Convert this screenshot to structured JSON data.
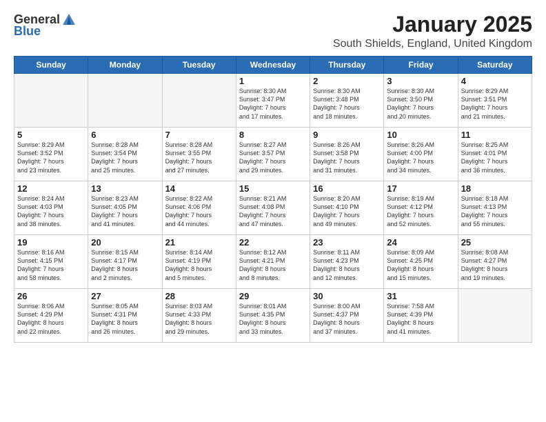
{
  "logo": {
    "general": "General",
    "blue": "Blue"
  },
  "title": "January 2025",
  "subtitle": "South Shields, England, United Kingdom",
  "days_of_week": [
    "Sunday",
    "Monday",
    "Tuesday",
    "Wednesday",
    "Thursday",
    "Friday",
    "Saturday"
  ],
  "weeks": [
    [
      {
        "day": "",
        "info": ""
      },
      {
        "day": "",
        "info": ""
      },
      {
        "day": "",
        "info": ""
      },
      {
        "day": "1",
        "info": "Sunrise: 8:30 AM\nSunset: 3:47 PM\nDaylight: 7 hours\nand 17 minutes."
      },
      {
        "day": "2",
        "info": "Sunrise: 8:30 AM\nSunset: 3:48 PM\nDaylight: 7 hours\nand 18 minutes."
      },
      {
        "day": "3",
        "info": "Sunrise: 8:30 AM\nSunset: 3:50 PM\nDaylight: 7 hours\nand 20 minutes."
      },
      {
        "day": "4",
        "info": "Sunrise: 8:29 AM\nSunset: 3:51 PM\nDaylight: 7 hours\nand 21 minutes."
      }
    ],
    [
      {
        "day": "5",
        "info": "Sunrise: 8:29 AM\nSunset: 3:52 PM\nDaylight: 7 hours\nand 23 minutes."
      },
      {
        "day": "6",
        "info": "Sunrise: 8:28 AM\nSunset: 3:54 PM\nDaylight: 7 hours\nand 25 minutes."
      },
      {
        "day": "7",
        "info": "Sunrise: 8:28 AM\nSunset: 3:55 PM\nDaylight: 7 hours\nand 27 minutes."
      },
      {
        "day": "8",
        "info": "Sunrise: 8:27 AM\nSunset: 3:57 PM\nDaylight: 7 hours\nand 29 minutes."
      },
      {
        "day": "9",
        "info": "Sunrise: 8:26 AM\nSunset: 3:58 PM\nDaylight: 7 hours\nand 31 minutes."
      },
      {
        "day": "10",
        "info": "Sunrise: 8:26 AM\nSunset: 4:00 PM\nDaylight: 7 hours\nand 34 minutes."
      },
      {
        "day": "11",
        "info": "Sunrise: 8:25 AM\nSunset: 4:01 PM\nDaylight: 7 hours\nand 36 minutes."
      }
    ],
    [
      {
        "day": "12",
        "info": "Sunrise: 8:24 AM\nSunset: 4:03 PM\nDaylight: 7 hours\nand 38 minutes."
      },
      {
        "day": "13",
        "info": "Sunrise: 8:23 AM\nSunset: 4:05 PM\nDaylight: 7 hours\nand 41 minutes."
      },
      {
        "day": "14",
        "info": "Sunrise: 8:22 AM\nSunset: 4:06 PM\nDaylight: 7 hours\nand 44 minutes."
      },
      {
        "day": "15",
        "info": "Sunrise: 8:21 AM\nSunset: 4:08 PM\nDaylight: 7 hours\nand 47 minutes."
      },
      {
        "day": "16",
        "info": "Sunrise: 8:20 AM\nSunset: 4:10 PM\nDaylight: 7 hours\nand 49 minutes."
      },
      {
        "day": "17",
        "info": "Sunrise: 8:19 AM\nSunset: 4:12 PM\nDaylight: 7 hours\nand 52 minutes."
      },
      {
        "day": "18",
        "info": "Sunrise: 8:18 AM\nSunset: 4:13 PM\nDaylight: 7 hours\nand 55 minutes."
      }
    ],
    [
      {
        "day": "19",
        "info": "Sunrise: 8:16 AM\nSunset: 4:15 PM\nDaylight: 7 hours\nand 58 minutes."
      },
      {
        "day": "20",
        "info": "Sunrise: 8:15 AM\nSunset: 4:17 PM\nDaylight: 8 hours\nand 2 minutes."
      },
      {
        "day": "21",
        "info": "Sunrise: 8:14 AM\nSunset: 4:19 PM\nDaylight: 8 hours\nand 5 minutes."
      },
      {
        "day": "22",
        "info": "Sunrise: 8:12 AM\nSunset: 4:21 PM\nDaylight: 8 hours\nand 8 minutes."
      },
      {
        "day": "23",
        "info": "Sunrise: 8:11 AM\nSunset: 4:23 PM\nDaylight: 8 hours\nand 12 minutes."
      },
      {
        "day": "24",
        "info": "Sunrise: 8:09 AM\nSunset: 4:25 PM\nDaylight: 8 hours\nand 15 minutes."
      },
      {
        "day": "25",
        "info": "Sunrise: 8:08 AM\nSunset: 4:27 PM\nDaylight: 8 hours\nand 19 minutes."
      }
    ],
    [
      {
        "day": "26",
        "info": "Sunrise: 8:06 AM\nSunset: 4:29 PM\nDaylight: 8 hours\nand 22 minutes."
      },
      {
        "day": "27",
        "info": "Sunrise: 8:05 AM\nSunset: 4:31 PM\nDaylight: 8 hours\nand 26 minutes."
      },
      {
        "day": "28",
        "info": "Sunrise: 8:03 AM\nSunset: 4:33 PM\nDaylight: 8 hours\nand 29 minutes."
      },
      {
        "day": "29",
        "info": "Sunrise: 8:01 AM\nSunset: 4:35 PM\nDaylight: 8 hours\nand 33 minutes."
      },
      {
        "day": "30",
        "info": "Sunrise: 8:00 AM\nSunset: 4:37 PM\nDaylight: 8 hours\nand 37 minutes."
      },
      {
        "day": "31",
        "info": "Sunrise: 7:58 AM\nSunset: 4:39 PM\nDaylight: 8 hours\nand 41 minutes."
      },
      {
        "day": "",
        "info": ""
      }
    ]
  ]
}
